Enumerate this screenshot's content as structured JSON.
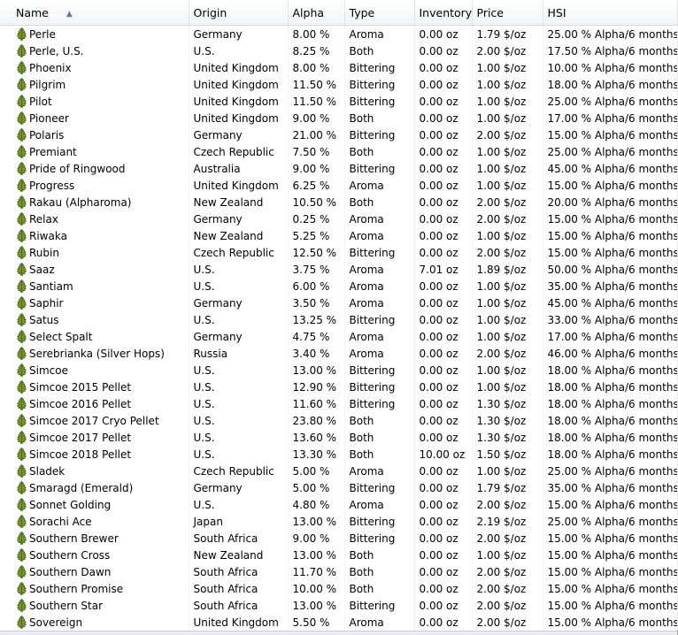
{
  "columns": {
    "name": "Name",
    "origin": "Origin",
    "alpha": "Alpha",
    "type": "Type",
    "inventory": "Inventory",
    "price": "Price",
    "hsi": "HSI"
  },
  "sort_icon": "sort-ascending-arrow",
  "row_icon": "hop-cone-icon",
  "rows": [
    {
      "name": "Perle",
      "origin": "Germany",
      "alpha": "8.00 %",
      "type": "Aroma",
      "inventory": "0.00 oz",
      "price": "1.79 $/oz",
      "hsi": "25.00 % Alpha/6 months"
    },
    {
      "name": "Perle, U.S.",
      "origin": "U.S.",
      "alpha": "8.25 %",
      "type": "Both",
      "inventory": "0.00 oz",
      "price": "2.00 $/oz",
      "hsi": "17.50 % Alpha/6 months"
    },
    {
      "name": "Phoenix",
      "origin": "United Kingdom",
      "alpha": "8.00 %",
      "type": "Bittering",
      "inventory": "0.00 oz",
      "price": "1.00 $/oz",
      "hsi": "10.00 % Alpha/6 months"
    },
    {
      "name": "Pilgrim",
      "origin": "United Kingdom",
      "alpha": "11.50 %",
      "type": "Bittering",
      "inventory": "0.00 oz",
      "price": "1.00 $/oz",
      "hsi": "18.00 % Alpha/6 months"
    },
    {
      "name": "Pilot",
      "origin": "United Kingdom",
      "alpha": "11.50 %",
      "type": "Bittering",
      "inventory": "0.00 oz",
      "price": "1.00 $/oz",
      "hsi": "25.00 % Alpha/6 months"
    },
    {
      "name": "Pioneer",
      "origin": "United Kingdom",
      "alpha": "9.00 %",
      "type": "Both",
      "inventory": "0.00 oz",
      "price": "1.00 $/oz",
      "hsi": "17.00 % Alpha/6 months"
    },
    {
      "name": "Polaris",
      "origin": "Germany",
      "alpha": "21.00 %",
      "type": "Bittering",
      "inventory": "0.00 oz",
      "price": "2.00 $/oz",
      "hsi": "15.00 % Alpha/6 months"
    },
    {
      "name": "Premiant",
      "origin": "Czech Republic",
      "alpha": "7.50 %",
      "type": "Both",
      "inventory": "0.00 oz",
      "price": "1.00 $/oz",
      "hsi": "25.00 % Alpha/6 months"
    },
    {
      "name": "Pride of Ringwood",
      "origin": "Australia",
      "alpha": "9.00 %",
      "type": "Bittering",
      "inventory": "0.00 oz",
      "price": "1.00 $/oz",
      "hsi": "45.00 % Alpha/6 months"
    },
    {
      "name": "Progress",
      "origin": "United Kingdom",
      "alpha": "6.25 %",
      "type": "Aroma",
      "inventory": "0.00 oz",
      "price": "1.00 $/oz",
      "hsi": "15.00 % Alpha/6 months"
    },
    {
      "name": "Rakau (Alpharoma)",
      "origin": "New Zealand",
      "alpha": "10.50 %",
      "type": "Both",
      "inventory": "0.00 oz",
      "price": "2.00 $/oz",
      "hsi": "20.00 % Alpha/6 months"
    },
    {
      "name": "Relax",
      "origin": "Germany",
      "alpha": "0.25 %",
      "type": "Aroma",
      "inventory": "0.00 oz",
      "price": "2.00 $/oz",
      "hsi": "15.00 % Alpha/6 months"
    },
    {
      "name": "Riwaka",
      "origin": "New Zealand",
      "alpha": "5.25 %",
      "type": "Aroma",
      "inventory": "0.00 oz",
      "price": "1.00 $/oz",
      "hsi": "15.00 % Alpha/6 months"
    },
    {
      "name": "Rubin",
      "origin": "Czech Republic",
      "alpha": "12.50 %",
      "type": "Bittering",
      "inventory": "0.00 oz",
      "price": "2.00 $/oz",
      "hsi": "15.00 % Alpha/6 months"
    },
    {
      "name": "Saaz",
      "origin": "U.S.",
      "alpha": "3.75 %",
      "type": "Aroma",
      "inventory": "7.01 oz",
      "price": "1.89 $/oz",
      "hsi": "50.00 % Alpha/6 months"
    },
    {
      "name": "Santiam",
      "origin": "U.S.",
      "alpha": "6.00 %",
      "type": "Aroma",
      "inventory": "0.00 oz",
      "price": "1.00 $/oz",
      "hsi": "35.00 % Alpha/6 months"
    },
    {
      "name": "Saphir",
      "origin": "Germany",
      "alpha": "3.50 %",
      "type": "Aroma",
      "inventory": "0.00 oz",
      "price": "1.00 $/oz",
      "hsi": "45.00 % Alpha/6 months"
    },
    {
      "name": "Satus",
      "origin": "U.S.",
      "alpha": "13.25 %",
      "type": "Bittering",
      "inventory": "0.00 oz",
      "price": "1.00 $/oz",
      "hsi": "33.00 % Alpha/6 months"
    },
    {
      "name": "Select Spalt",
      "origin": "Germany",
      "alpha": "4.75 %",
      "type": "Aroma",
      "inventory": "0.00 oz",
      "price": "1.00 $/oz",
      "hsi": "17.00 % Alpha/6 months"
    },
    {
      "name": "Serebrianka (Silver Hops)",
      "origin": "Russia",
      "alpha": "3.40 %",
      "type": "Aroma",
      "inventory": "0.00 oz",
      "price": "2.00 $/oz",
      "hsi": "46.00 % Alpha/6 months"
    },
    {
      "name": "Simcoe",
      "origin": "U.S.",
      "alpha": "13.00 %",
      "type": "Bittering",
      "inventory": "0.00 oz",
      "price": "1.00 $/oz",
      "hsi": "18.00 % Alpha/6 months"
    },
    {
      "name": "Simcoe 2015 Pellet",
      "origin": "U.S.",
      "alpha": "12.90 %",
      "type": "Bittering",
      "inventory": "0.00 oz",
      "price": "1.00 $/oz",
      "hsi": "18.00 % Alpha/6 months"
    },
    {
      "name": "Simcoe 2016 Pellet",
      "origin": "U.S.",
      "alpha": "11.60 %",
      "type": "Bittering",
      "inventory": "0.00 oz",
      "price": "1.30 $/oz",
      "hsi": "18.00 % Alpha/6 months"
    },
    {
      "name": "Simcoe 2017 Cryo Pellet",
      "origin": "U.S.",
      "alpha": "23.80 %",
      "type": "Both",
      "inventory": "0.00 oz",
      "price": "1.30 $/oz",
      "hsi": "18.00 % Alpha/6 months"
    },
    {
      "name": "Simcoe 2017 Pellet",
      "origin": "U.S.",
      "alpha": "13.60 %",
      "type": "Both",
      "inventory": "0.00 oz",
      "price": "1.30 $/oz",
      "hsi": "18.00 % Alpha/6 months"
    },
    {
      "name": "Simcoe 2018 Pellet",
      "origin": "U.S.",
      "alpha": "13.30 %",
      "type": "Both",
      "inventory": "10.00 oz",
      "price": "1.50 $/oz",
      "hsi": "18.00 % Alpha/6 months"
    },
    {
      "name": "Sladek",
      "origin": "Czech Republic",
      "alpha": "5.00 %",
      "type": "Aroma",
      "inventory": "0.00 oz",
      "price": "1.00 $/oz",
      "hsi": "25.00 % Alpha/6 months"
    },
    {
      "name": "Smaragd (Emerald)",
      "origin": "Germany",
      "alpha": "5.00 %",
      "type": "Bittering",
      "inventory": "0.00 oz",
      "price": "1.79 $/oz",
      "hsi": "35.00 % Alpha/6 months"
    },
    {
      "name": "Sonnet Golding",
      "origin": "U.S.",
      "alpha": "4.80 %",
      "type": "Aroma",
      "inventory": "0.00 oz",
      "price": "2.00 $/oz",
      "hsi": "15.00 % Alpha/6 months"
    },
    {
      "name": "Sorachi Ace",
      "origin": "Japan",
      "alpha": "13.00 %",
      "type": "Bittering",
      "inventory": "0.00 oz",
      "price": "2.19 $/oz",
      "hsi": "25.00 % Alpha/6 months"
    },
    {
      "name": "Southern Brewer",
      "origin": "South Africa",
      "alpha": "9.00 %",
      "type": "Bittering",
      "inventory": "0.00 oz",
      "price": "2.00 $/oz",
      "hsi": "15.00 % Alpha/6 months"
    },
    {
      "name": "Southern Cross",
      "origin": "New Zealand",
      "alpha": "13.00 %",
      "type": "Both",
      "inventory": "0.00 oz",
      "price": "1.00 $/oz",
      "hsi": "15.00 % Alpha/6 months"
    },
    {
      "name": "Southern Dawn",
      "origin": "South Africa",
      "alpha": "11.70 %",
      "type": "Both",
      "inventory": "0.00 oz",
      "price": "2.00 $/oz",
      "hsi": "15.00 % Alpha/6 months"
    },
    {
      "name": "Southern Promise",
      "origin": "South Africa",
      "alpha": "10.00 %",
      "type": "Both",
      "inventory": "0.00 oz",
      "price": "2.00 $/oz",
      "hsi": "15.00 % Alpha/6 months"
    },
    {
      "name": "Southern Star",
      "origin": "South Africa",
      "alpha": "13.00 %",
      "type": "Bittering",
      "inventory": "0.00 oz",
      "price": "2.00 $/oz",
      "hsi": "15.00 % Alpha/6 months"
    },
    {
      "name": "Sovereign",
      "origin": "United Kingdom",
      "alpha": "5.50 %",
      "type": "Aroma",
      "inventory": "0.00 oz",
      "price": "2.00 $/oz",
      "hsi": "15.00 % Alpha/6 months"
    }
  ]
}
